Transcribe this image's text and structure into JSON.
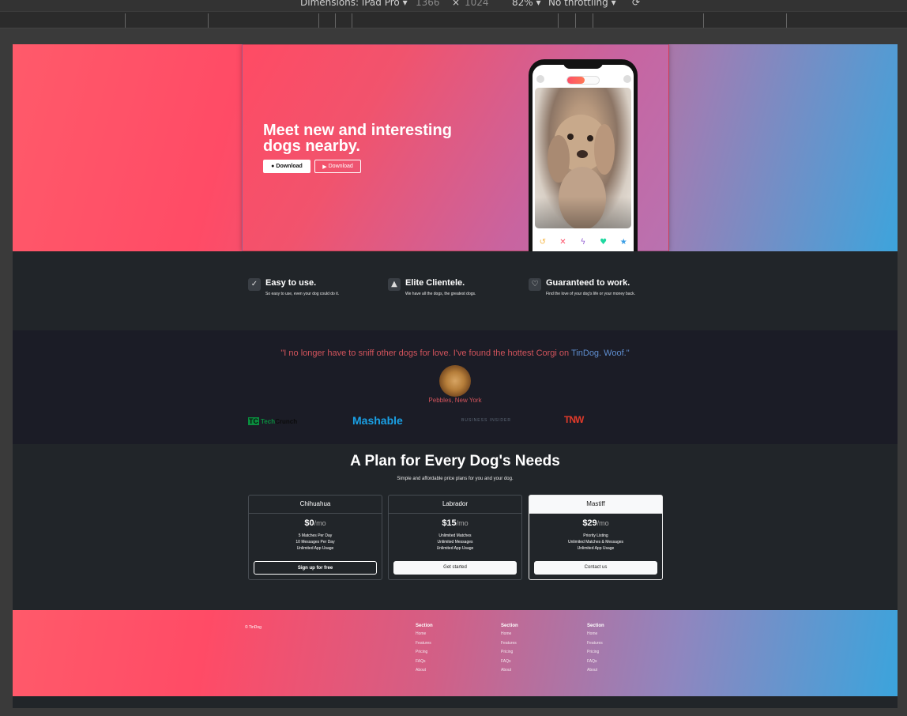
{
  "devtools": {
    "dimensions_label": "Dimensions: iPad Pro",
    "width": "1366",
    "height": "1024",
    "zoom": "82%",
    "throttling": "No throttling"
  },
  "hero": {
    "title": "Meet new and interesting dogs nearby.",
    "buttons": [
      {
        "label": "Download",
        "icon": "apple-icon"
      },
      {
        "label": "Download",
        "icon": "play-icon"
      }
    ]
  },
  "features": [
    {
      "title": "Easy to use.",
      "desc": "So easy to use, even your dog could do it.",
      "icon": "check-circle-icon"
    },
    {
      "title": "Elite Clientele.",
      "desc": "We have all the dogs, the greatest dogs.",
      "icon": "graduation-cap-icon"
    },
    {
      "title": "Guaranteed to work.",
      "desc": "Find the love of your dog's life or your money back.",
      "icon": "heart-arrow-icon"
    }
  ],
  "testimonial": {
    "quote_prefix": "\"I no longer have to sniff other dogs for love. I've found the hottest Corgi on ",
    "quote_brand": "TinDog. Woof.\"",
    "author": "Pebbles, New York"
  },
  "press": {
    "techcrunch_tc": "TC",
    "techcrunch_tech": "Tech",
    "techcrunch_crunch": "Crunch",
    "mashable": "Mashable",
    "business_insider": "BUSINESS INSIDER",
    "tnw": "TNW"
  },
  "pricing": {
    "title": "A Plan for Every Dog's Needs",
    "subtitle": "Simple and affordable price plans for you and your dog.",
    "plans": [
      {
        "name": "Chihuahua",
        "price": "$0",
        "period": "/mo",
        "features": [
          "5 Matches Per Day",
          "10 Messages Per Day",
          "Unlimited App Usage"
        ],
        "button": "Sign up for free"
      },
      {
        "name": "Labrador",
        "price": "$15",
        "period": "/mo",
        "features": [
          "Unlimited Matches",
          "Unlimited Messages",
          "Unlimited App Usage"
        ],
        "button": "Get started"
      },
      {
        "name": "Mastiff",
        "price": "$29",
        "period": "/mo",
        "features": [
          "Priority Listing",
          "Unlimited Matches & Messages",
          "Unlimited App Usage"
        ],
        "button": "Contact us"
      }
    ]
  },
  "footer": {
    "copyright": "© TinDog",
    "columns": [
      {
        "heading": "Section",
        "links": [
          "Home",
          "Features",
          "Pricing",
          "FAQs",
          "About"
        ]
      },
      {
        "heading": "Section",
        "links": [
          "Home",
          "Features",
          "Pricing",
          "FAQs",
          "About"
        ]
      },
      {
        "heading": "Section",
        "links": [
          "Home",
          "Features",
          "Pricing",
          "FAQs",
          "About"
        ]
      }
    ]
  },
  "colors": {
    "accent_pink": "#ff4b66",
    "accent_blue": "#3da4dc",
    "dark_bg": "#212529",
    "quote_red": "#d3545c"
  }
}
